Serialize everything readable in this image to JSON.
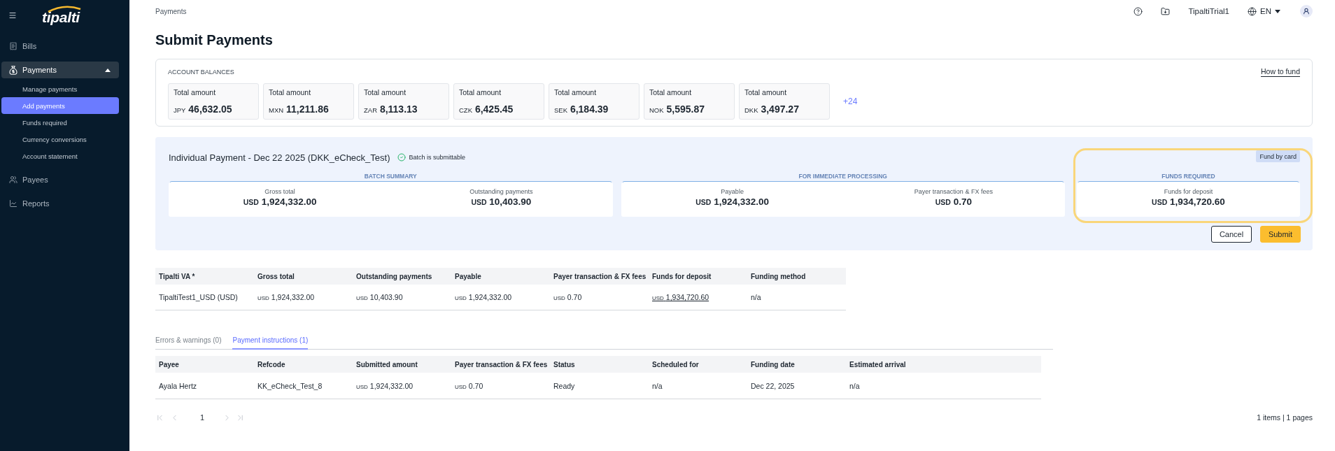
{
  "sidebar": {
    "logo": "tipalti",
    "items": [
      {
        "label": "Bills",
        "selected": false
      },
      {
        "label": "Payments",
        "selected": true,
        "expanded": true,
        "children": [
          {
            "label": "Manage payments",
            "selected": false
          },
          {
            "label": "Add payments",
            "selected": true
          },
          {
            "label": "Funds required",
            "selected": false
          },
          {
            "label": "Currency conversions",
            "selected": false
          },
          {
            "label": "Account statement",
            "selected": false
          }
        ]
      },
      {
        "label": "Payees",
        "selected": false
      },
      {
        "label": "Reports",
        "selected": false
      }
    ]
  },
  "header": {
    "breadcrumb": "Payments",
    "account": "TipaltiTrial1",
    "language": "EN"
  },
  "title": "Submit Payments",
  "account_balances": {
    "heading": "ACCOUNT BALANCES",
    "link": "How to fund",
    "balances": [
      {
        "label": "Total amount",
        "currency": "JPY",
        "amount": "46,632.05"
      },
      {
        "label": "Total amount",
        "currency": "MXN",
        "amount": "11,211.86"
      },
      {
        "label": "Total amount",
        "currency": "ZAR",
        "amount": "8,113.13"
      },
      {
        "label": "Total amount",
        "currency": "CZK",
        "amount": "6,425.45"
      },
      {
        "label": "Total amount",
        "currency": "SEK",
        "amount": "6,184.39"
      },
      {
        "label": "Total amount",
        "currency": "NOK",
        "amount": "5,595.87"
      },
      {
        "label": "Total amount",
        "currency": "DKK",
        "amount": "3,497.27"
      }
    ],
    "more": "+24"
  },
  "batch": {
    "title": "Individual Payment - Dec 22 2025 (DKK_eCheck_Test)",
    "status": "Batch is submittable",
    "sections": [
      {
        "heading": "BATCH SUMMARY",
        "highlighted": false,
        "metrics": [
          {
            "label": "Gross total",
            "currency": "USD",
            "amount": "1,924,332.00"
          },
          {
            "label": "Outstanding payments",
            "currency": "USD",
            "amount": "10,403.90"
          }
        ]
      },
      {
        "heading": "FOR IMMEDIATE PROCESSING",
        "highlighted": false,
        "metrics": [
          {
            "label": "Payable",
            "currency": "USD",
            "amount": "1,924,332.00"
          },
          {
            "label": "Payer transaction & FX fees",
            "currency": "USD",
            "amount": "0.70"
          }
        ]
      },
      {
        "heading": "FUNDS REQUIRED",
        "highlighted": true,
        "button": "Fund by card",
        "metrics": [
          {
            "label": "Funds for deposit",
            "currency": "USD",
            "amount": "1,934,720.60"
          }
        ]
      }
    ],
    "buttons": [
      {
        "label": "Cancel",
        "kind": "secondary"
      },
      {
        "label": "Submit",
        "kind": "primary"
      }
    ]
  },
  "accounts_table": {
    "columns": [
      "Tipalti VA *",
      "Gross total",
      "Outstanding payments",
      "Payable",
      "Payer transaction & FX fees",
      "Funds for deposit",
      "Funding method"
    ],
    "rows": [
      [
        {
          "kind": "text",
          "text": "TipaltiTest1_USD (USD)"
        },
        {
          "kind": "money",
          "currency": "USD",
          "amount": "1,924,332.00"
        },
        {
          "kind": "money",
          "currency": "USD",
          "amount": "10,403.90"
        },
        {
          "kind": "money",
          "currency": "USD",
          "amount": "1,924,332.00"
        },
        {
          "kind": "money",
          "currency": "USD",
          "amount": "0.70"
        },
        {
          "kind": "link",
          "currency": "USD",
          "amount": "1,934,720.60"
        },
        {
          "kind": "text",
          "text": "n/a"
        }
      ]
    ]
  },
  "tabs": [
    {
      "label": "Errors & warnings (0)",
      "selected": false
    },
    {
      "label": "Payment instructions (1)",
      "selected": true
    }
  ],
  "instructions_table": {
    "columns": [
      "Payee",
      "Refcode",
      "Submitted amount",
      "Payer transaction & FX fees",
      "Status",
      "Scheduled for",
      "Funding date",
      "Estimated arrival"
    ],
    "rows": [
      [
        {
          "kind": "text",
          "text": "Ayala Hertz"
        },
        {
          "kind": "text",
          "text": "KK_eCheck_Test_8"
        },
        {
          "kind": "money",
          "currency": "USD",
          "amount": "1,924,332.00"
        },
        {
          "kind": "money",
          "currency": "USD",
          "amount": "0.70"
        },
        {
          "kind": "text",
          "text": "Ready"
        },
        {
          "kind": "text",
          "text": "n/a"
        },
        {
          "kind": "text",
          "text": "Dec 22, 2025"
        },
        {
          "kind": "text",
          "text": "n/a"
        }
      ]
    ]
  },
  "pagination": {
    "previous_disabled": true,
    "next_disabled": true,
    "page": "1",
    "summary": "1 items | 1 pages"
  }
}
